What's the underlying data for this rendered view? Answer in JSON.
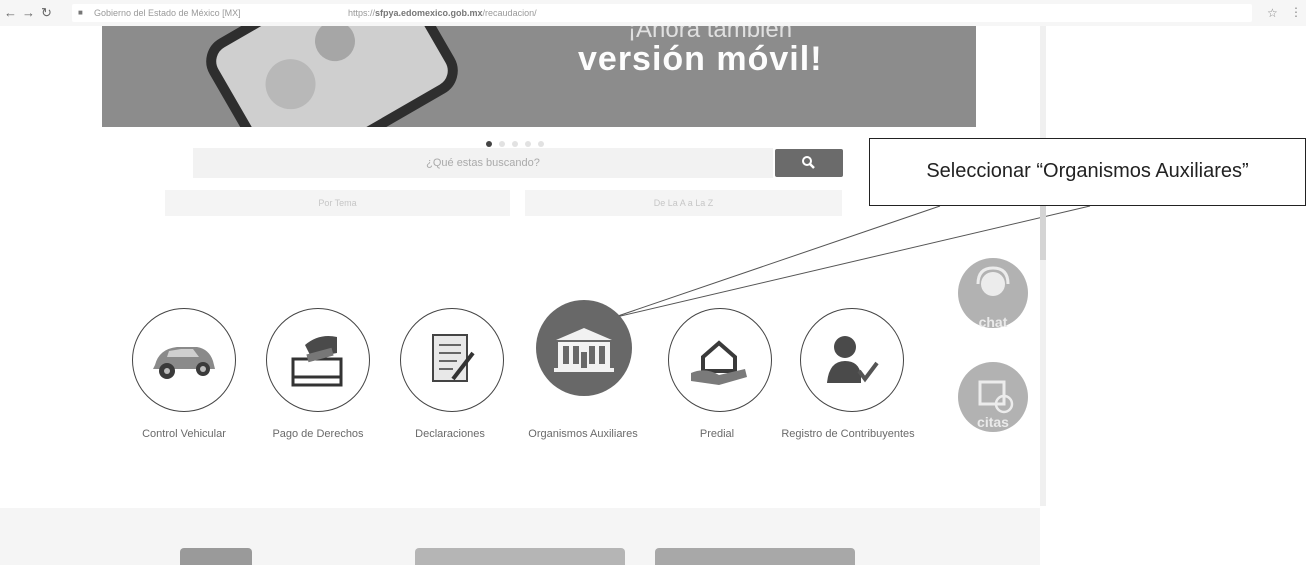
{
  "browser": {
    "site_name": "Gobierno del Estado de México [MX]",
    "url_prefix": "https://",
    "url_host": "sfpya.edomexico.gob.mx",
    "url_path": "/recaudacion/"
  },
  "banner": {
    "line1": "¡Ahora también",
    "title": "versión móvil!"
  },
  "carousel": {
    "dots": 5,
    "active_index": 0
  },
  "search": {
    "placeholder": "¿Qué estas buscando?",
    "by_topic_label": "Por Tema",
    "a_to_z_label": "De La A a La Z"
  },
  "services": [
    {
      "label": "Control Vehicular",
      "icon": "car-icon"
    },
    {
      "label": "Pago de Derechos",
      "icon": "payment-card-icon"
    },
    {
      "label": "Declaraciones",
      "icon": "document-pen-icon"
    },
    {
      "label": "Organismos Auxiliares",
      "icon": "building-icon",
      "active": true
    },
    {
      "label": "Predial",
      "icon": "house-hand-icon"
    },
    {
      "label": "Registro de Contribuyentes",
      "icon": "person-check-icon"
    }
  ],
  "floating": {
    "chat_label": "chat",
    "citas_label": "citas"
  },
  "annotation": {
    "text": "Seleccionar “Organismos Auxiliares”"
  },
  "colors": {
    "active_circle": "#686868",
    "search_button": "#6b6b6b",
    "banner": "#8c8c8c"
  }
}
